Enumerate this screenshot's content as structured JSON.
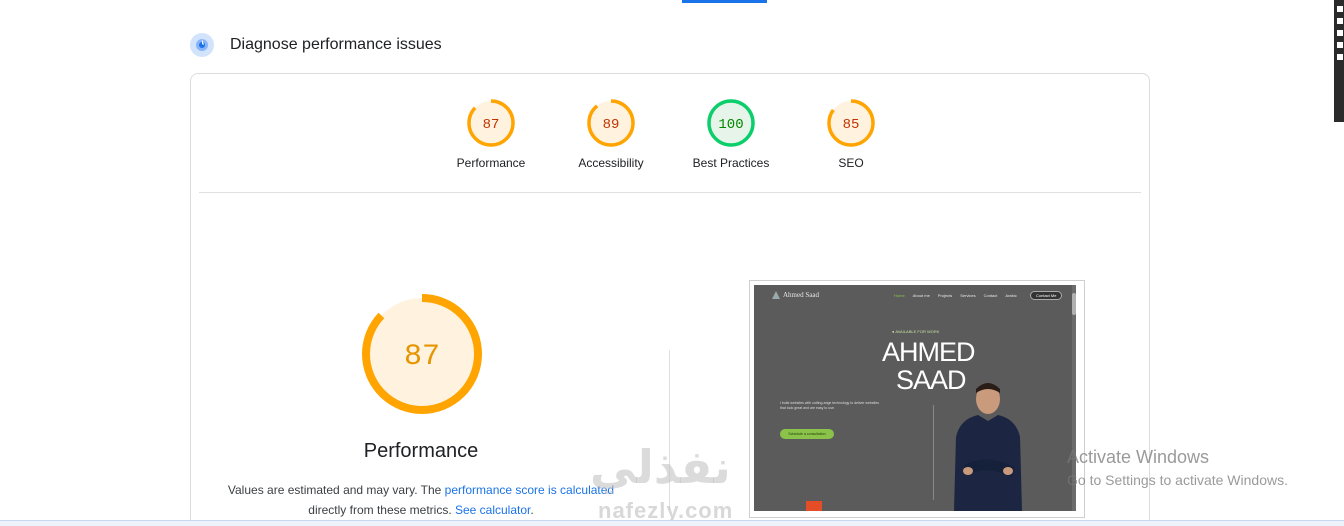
{
  "header": {
    "title": "Diagnose performance issues",
    "icon": "lighthouse-icon"
  },
  "scores": [
    {
      "label": "Performance",
      "value": "87",
      "score": 87,
      "color": "#ffa400",
      "text_color": "#c33300",
      "bg": "#fff3e0"
    },
    {
      "label": "Accessibility",
      "value": "89",
      "score": 89,
      "color": "#ffa400",
      "text_color": "#c33300",
      "bg": "#fff3e0"
    },
    {
      "label": "Best Practices",
      "value": "100",
      "score": 100,
      "color": "#0cce6b",
      "text_color": "#008800",
      "bg": "#e6f4ea"
    },
    {
      "label": "SEO",
      "value": "85",
      "score": 85,
      "color": "#ffa400",
      "text_color": "#c33300",
      "bg": "#fff3e0"
    }
  ],
  "main": {
    "score": "87",
    "score_value": 87,
    "label": "Performance",
    "note_prefix": "Values are estimated and may vary. The ",
    "note_link": "performance score is calculated",
    "note_mid": "directly from these metrics. ",
    "note_link2": "See calculator",
    "note_end": "."
  },
  "screenshot": {
    "logo": "Ahmed Saad",
    "nav_links": [
      "Home",
      "About me",
      "Projects",
      "Services",
      "Contact",
      "Arabic"
    ],
    "contact_button": "Contact Me",
    "available": "AVAILABLE FOR WORK",
    "name_line1": "AHMED",
    "name_line2": "SAAD",
    "description": "I build websites with cutting-edge technology to deliver websites that look great and are easy to use.",
    "cta": "Schedule a consultation"
  },
  "watermark": {
    "arabic": "نفذلي",
    "latin": "nafezly.com"
  },
  "os_notice": {
    "title": "Activate Windows",
    "subtitle": "Go to Settings to activate Windows."
  },
  "colors": {
    "accent": "#1a73e8",
    "average": "#ffa400",
    "pass": "#0cce6b"
  }
}
